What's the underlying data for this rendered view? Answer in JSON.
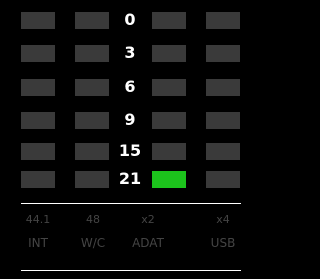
{
  "meter": {
    "levels": [
      "0",
      "3",
      "6",
      "9",
      "15",
      "21"
    ],
    "active_row_index": 5,
    "active_cell_column": 3,
    "inactive_color": "#3a3a3a",
    "active_color": "#1cc31c"
  },
  "sample_rates": [
    "44.1",
    "48",
    "x2",
    "x4"
  ],
  "sync_sources": [
    "INT",
    "W/C",
    "ADAT",
    "USB"
  ],
  "colors": {
    "background": "#000000",
    "level_text": "#ffffff",
    "dim_text": "#444444"
  }
}
